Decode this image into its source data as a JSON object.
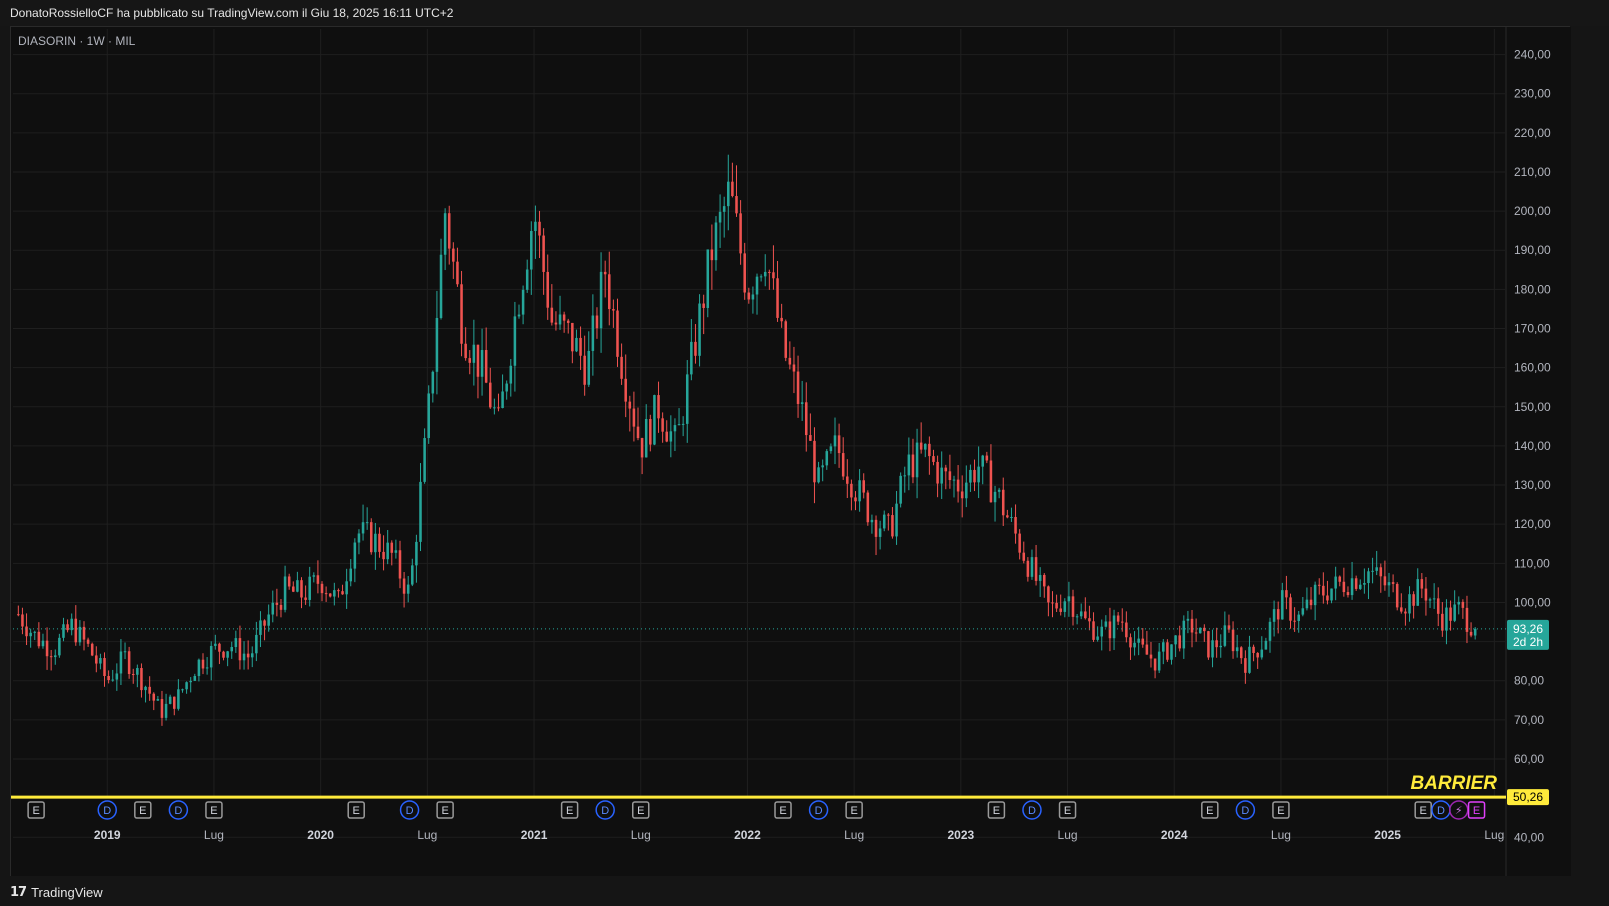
{
  "header": {
    "publisher_line": "DonatoRossielloCF ha pubblicato su TradingView.com il Giu 18, 2025 16:11 UTC+2"
  },
  "legend": {
    "symbol_line": "DIASORIN · 1W · MIL"
  },
  "footer": {
    "logo_mark": "𝟭𝟳",
    "logo_text": "TradingView"
  },
  "colors": {
    "up": "#26a69a",
    "down": "#ef5350",
    "barrier": "#ffeb3b",
    "background": "#0f0f0f",
    "grid": "#1f1f1f",
    "dividend_marker": "#2962ff",
    "split_marker": "#9c27b0",
    "earnings_marker": "#9a9a9a",
    "earnings_highlight": "#e040fb"
  },
  "chart_data": {
    "type": "candlestick",
    "symbol": "DIASORIN",
    "timeframe": "1W",
    "exchange": "MIL",
    "x_range": [
      "2018-08",
      "2025-07"
    ],
    "ylim": [
      37,
      245
    ],
    "y_ticks": [
      40,
      50,
      60,
      70,
      80,
      90,
      100,
      110,
      120,
      130,
      140,
      150,
      160,
      170,
      180,
      190,
      200,
      210,
      220,
      230,
      240
    ],
    "y_tick_labels": [
      "40,00",
      "",
      "60,00",
      "70,00",
      "80,00",
      "",
      "100,00",
      "110,00",
      "120,00",
      "130,00",
      "140,00",
      "150,00",
      "160,00",
      "170,00",
      "180,00",
      "190,00",
      "200,00",
      "210,00",
      "220,00",
      "230,00",
      "240,00"
    ],
    "x_ticks": [
      {
        "date": "2019-01",
        "label": "2019"
      },
      {
        "date": "2019-07",
        "label": "Lug"
      },
      {
        "date": "2020-01",
        "label": "2020"
      },
      {
        "date": "2020-07",
        "label": "Lug"
      },
      {
        "date": "2021-01",
        "label": "2021"
      },
      {
        "date": "2021-07",
        "label": "Lug"
      },
      {
        "date": "2022-01",
        "label": "2022"
      },
      {
        "date": "2022-07",
        "label": "Lug"
      },
      {
        "date": "2023-01",
        "label": "2023"
      },
      {
        "date": "2023-07",
        "label": "Lug"
      },
      {
        "date": "2024-01",
        "label": "2024"
      },
      {
        "date": "2024-07",
        "label": "Lug"
      },
      {
        "date": "2025-01",
        "label": "2025"
      },
      {
        "date": "2025-07",
        "label": "Lug"
      }
    ],
    "close_path": [
      [
        "2018-08",
        97
      ],
      [
        "2018-09",
        91
      ],
      [
        "2018-10",
        88
      ],
      [
        "2018-11",
        94
      ],
      [
        "2018-12",
        88
      ],
      [
        "2019-01",
        80
      ],
      [
        "2019-02",
        86
      ],
      [
        "2019-03",
        80
      ],
      [
        "2019-04",
        72
      ],
      [
        "2019-05",
        76
      ],
      [
        "2019-06",
        84
      ],
      [
        "2019-07",
        88
      ],
      [
        "2019-08",
        89
      ],
      [
        "2019-09",
        86
      ],
      [
        "2019-10",
        96
      ],
      [
        "2019-11",
        103
      ],
      [
        "2019-12",
        102
      ],
      [
        "2020-01",
        106
      ],
      [
        "2020-02",
        100
      ],
      [
        "2020-03",
        118
      ],
      [
        "2020-04",
        116
      ],
      [
        "2020-05",
        112
      ],
      [
        "2020-06",
        102
      ],
      [
        "2020-07",
        145
      ],
      [
        "2020-08",
        200
      ],
      [
        "2020-09",
        170
      ],
      [
        "2020-10",
        160
      ],
      [
        "2020-11",
        145
      ],
      [
        "2020-12",
        175
      ],
      [
        "2021-01",
        200
      ],
      [
        "2021-02",
        172
      ],
      [
        "2021-03",
        168
      ],
      [
        "2021-04",
        160
      ],
      [
        "2021-05",
        185
      ],
      [
        "2021-06",
        160
      ],
      [
        "2021-07",
        140
      ],
      [
        "2021-08",
        150
      ],
      [
        "2021-09",
        140
      ],
      [
        "2021-10",
        165
      ],
      [
        "2021-11",
        190
      ],
      [
        "2021-12",
        205
      ],
      [
        "2022-01",
        180
      ],
      [
        "2022-02",
        190
      ],
      [
        "2022-03",
        165
      ],
      [
        "2022-04",
        150
      ],
      [
        "2022-05",
        130
      ],
      [
        "2022-06",
        140
      ],
      [
        "2022-07",
        130
      ],
      [
        "2022-08",
        122
      ],
      [
        "2022-09",
        118
      ],
      [
        "2022-10",
        135
      ],
      [
        "2022-11",
        138
      ],
      [
        "2022-12",
        132
      ],
      [
        "2023-01",
        130
      ],
      [
        "2023-02",
        135
      ],
      [
        "2023-03",
        128
      ],
      [
        "2023-04",
        118
      ],
      [
        "2023-05",
        108
      ],
      [
        "2023-06",
        98
      ],
      [
        "2023-07",
        102
      ],
      [
        "2023-08",
        95
      ],
      [
        "2023-09",
        92
      ],
      [
        "2023-10",
        96
      ],
      [
        "2023-11",
        88
      ],
      [
        "2023-12",
        85
      ],
      [
        "2024-01",
        90
      ],
      [
        "2024-02",
        94
      ],
      [
        "2024-03",
        88
      ],
      [
        "2024-04",
        92
      ],
      [
        "2024-05",
        85
      ],
      [
        "2024-06",
        90
      ],
      [
        "2024-07",
        100
      ],
      [
        "2024-08",
        96
      ],
      [
        "2024-09",
        102
      ],
      [
        "2024-10",
        104
      ],
      [
        "2024-11",
        106
      ],
      [
        "2024-12",
        108
      ],
      [
        "2025-01",
        104
      ],
      [
        "2025-02",
        100
      ],
      [
        "2025-03",
        104
      ],
      [
        "2025-04",
        96
      ],
      [
        "2025-05",
        98
      ],
      [
        "2025-06",
        93.26
      ]
    ],
    "last_price": 93.26,
    "last_price_label": "93,26",
    "countdown_label": "2d 2h",
    "barrier": {
      "label": "BARRIER",
      "value": 50.26,
      "value_label": "50,26"
    },
    "events": [
      {
        "date": "2018-09",
        "kind": "E"
      },
      {
        "date": "2019-01",
        "kind": "D"
      },
      {
        "date": "2019-03",
        "kind": "E"
      },
      {
        "date": "2019-05",
        "kind": "D"
      },
      {
        "date": "2019-07",
        "kind": "E"
      },
      {
        "date": "2020-03",
        "kind": "E"
      },
      {
        "date": "2020-06",
        "kind": "D"
      },
      {
        "date": "2020-08",
        "kind": "E"
      },
      {
        "date": "2021-03",
        "kind": "E"
      },
      {
        "date": "2021-05",
        "kind": "D"
      },
      {
        "date": "2021-07",
        "kind": "E"
      },
      {
        "date": "2022-03",
        "kind": "E"
      },
      {
        "date": "2022-05",
        "kind": "D"
      },
      {
        "date": "2022-07",
        "kind": "E"
      },
      {
        "date": "2023-03",
        "kind": "E"
      },
      {
        "date": "2023-05",
        "kind": "D"
      },
      {
        "date": "2023-07",
        "kind": "E"
      },
      {
        "date": "2024-03",
        "kind": "E"
      },
      {
        "date": "2024-05",
        "kind": "D"
      },
      {
        "date": "2024-07",
        "kind": "E"
      },
      {
        "date": "2025-03",
        "kind": "E"
      },
      {
        "date": "2025-04",
        "kind": "D"
      },
      {
        "date": "2025-05",
        "kind": "S"
      },
      {
        "date": "2025-06",
        "kind": "E",
        "highlight": true
      }
    ]
  }
}
